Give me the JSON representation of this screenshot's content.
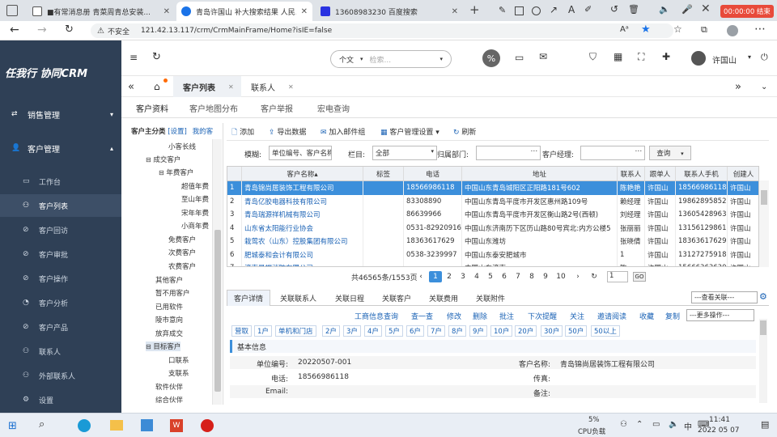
{
  "browser": {
    "tabs": [
      {
        "title": "■有常消息册 青菜周青总安装...",
        "fav_color": "#555"
      },
      {
        "title": "青岛许国山 补大搜索结果 人民...",
        "fav_color": "#1a73e8"
      },
      {
        "title": "13608983230 百度搜索",
        "fav_color": "#2932e1"
      }
    ],
    "new_tab": "+",
    "recording": "00:00:00 结束",
    "insecure": "不安全",
    "url": "121.42.13.117/crm/CrmMainFrame/Home?isIE=false"
  },
  "app": {
    "logo": "任我行 协同CRM",
    "lang": "个文",
    "search_placeholder": "检索...",
    "user": "许国山",
    "page_tabs": {
      "home": "⌂",
      "list": "客户列表",
      "contacts": "联系人"
    },
    "sub_tabs": [
      "客户资料",
      "客户地图分布",
      "客户举报",
      "宏电查询"
    ]
  },
  "sidebar": {
    "sections": [
      {
        "label": "销售管理",
        "icon": "sales-icon",
        "arrow": "▾"
      },
      {
        "label": "客户管理",
        "icon": "customer-icon",
        "arrow": "▴"
      }
    ],
    "items": [
      {
        "label": "工作台",
        "icon": "desktop-icon"
      },
      {
        "label": "客户列表",
        "icon": "user-list-icon"
      },
      {
        "label": "客户回访",
        "icon": "revisit-icon"
      },
      {
        "label": "客户审批",
        "icon": "approve-icon"
      },
      {
        "label": "客户操作",
        "icon": "operate-icon"
      },
      {
        "label": "客户分析",
        "icon": "analysis-icon"
      },
      {
        "label": "客户产品",
        "icon": "product-icon"
      },
      {
        "label": "联系人",
        "icon": "contact-icon"
      },
      {
        "label": "外部联系人",
        "icon": "ext-contact-icon"
      },
      {
        "label": "设置",
        "icon": "settings-icon"
      }
    ]
  },
  "tree": {
    "header": "客户主分类",
    "setting": "[设置]",
    "mine": "我的客",
    "nodes": [
      "小客长线",
      "成交客户",
      "年费客户",
      "超值年费",
      "至山年费",
      "宋年年费",
      "小商年费",
      "免费客户",
      "次费客户",
      "农费客户",
      "其他客户",
      "暂不用客户",
      "已用软件",
      "陵市意向",
      "放弃成交",
      "目标客户",
      "口联系",
      "支联系",
      "软件伙伴",
      "综合伙伴"
    ]
  },
  "toolbar": {
    "add": "添加",
    "export": "导出数据",
    "mail": "加入邮件组",
    "settings": "客户管理设置",
    "refresh": "刷新"
  },
  "filter": {
    "label_title": "模糊:",
    "title_value": "单位编号、客户名称",
    "label_column": "栏目:",
    "column_value": "全部",
    "label_dept": "归属部门:",
    "label_manager": "客户经理:",
    "query": "查询"
  },
  "grid": {
    "headers": [
      "",
      "客户名称▴",
      "标签",
      "电话",
      "地址",
      "联系人",
      "跟单人",
      "联系人手机",
      "创建人"
    ],
    "rows": [
      {
        "no": "1",
        "name": "青岛锦尚居装饰工程有限公司",
        "tag": "",
        "phone": "18566986118",
        "address": "中国山东青岛城阳区正阳路181号602",
        "contact": "陈艳艳",
        "follower": "许国山",
        "mobile": "18566986118",
        "creator": "许国山"
      },
      {
        "no": "2",
        "name": "青岛亿胶电器科技有限公司",
        "tag": "",
        "phone": "83308890",
        "address": "中国山东青岛平度市开发区惠州路109号",
        "contact": "赖经理",
        "follower": "许国山",
        "mobile": "19862895852",
        "creator": "许国山"
      },
      {
        "no": "3",
        "name": "青岛瑞源祥机械有限公司",
        "tag": "",
        "phone": "86639966",
        "address": "中国山东青岛平度市开发区衡山路2号(西顿)",
        "contact": "刘经理",
        "follower": "许国山",
        "mobile": "13605428963",
        "creator": "许国山"
      },
      {
        "no": "4",
        "name": "山东省太阳能行业协会",
        "tag": "",
        "phone": "0531-82920916",
        "address": "中国山东济南历下区历山路80号宾北:内方公楼5",
        "contact": "张丽丽",
        "follower": "许国山",
        "mobile": "13156129861",
        "creator": "许国山"
      },
      {
        "no": "5",
        "name": "栽莺农（山东）控股集团有限公司",
        "tag": "",
        "phone": "18363617629",
        "address": "中国山东潍坊",
        "contact": "张晓倩",
        "follower": "许国山",
        "mobile": "18363617629",
        "creator": "许国山"
      },
      {
        "no": "6",
        "name": "肥城泰和会计有限公司",
        "tag": "",
        "phone": "0538-3239997",
        "address": "中国山东泰安肥城市",
        "contact": "1",
        "follower": "许国山",
        "mobile": "13127275918",
        "creator": "许国山"
      },
      {
        "no": "7",
        "name": "济南星端消防有限公司",
        "tag": "",
        "phone": "",
        "address": "中国山东济南",
        "contact": "陈",
        "follower": "许国山",
        "mobile": "15666363630",
        "creator": "许国山"
      }
    ]
  },
  "pager": {
    "summary": "共46565条/1553页",
    "pages": [
      "1",
      "2",
      "3",
      "4",
      "5",
      "6",
      "7",
      "8",
      "9",
      "10"
    ],
    "current": "1",
    "input": "1",
    "go": "GO"
  },
  "detail": {
    "tabs": [
      "客户详情",
      "关联联系人",
      "关联日程",
      "关联客户",
      "关联费用",
      "关联附件"
    ],
    "view_select": "---查看关联---",
    "actions": [
      "工商信息查询",
      "查一查",
      "修改",
      "删除",
      "批注",
      "下次提醒",
      "关注",
      "邀请阅读",
      "收藏",
      "复制"
    ],
    "more_ops": "---更多操作---",
    "time_buttons": [
      "营取",
      "1户",
      "单机和门店",
      "2户",
      "3户",
      "4户",
      "5户",
      "6户",
      "7户",
      "8户",
      "9户",
      "10户",
      "20户",
      "30户",
      "50户",
      "50以上"
    ],
    "section": "基本信息",
    "fields": {
      "code_label": "单位编号:",
      "code": "20220507-001",
      "name_label": "客户名称:",
      "name": "青岛锦尚居装饰工程有限公司",
      "phone_label": "电话:",
      "phone": "18566986118",
      "fax_label": "传真:",
      "fax": "",
      "email_label": "Email:",
      "email": "",
      "note_label": "备注:",
      "note": ""
    }
  },
  "taskbar": {
    "cpu": "5%",
    "cpu_label": "CPU负载",
    "time": "11:41",
    "date": "2022 05 07",
    "ime": "中"
  }
}
